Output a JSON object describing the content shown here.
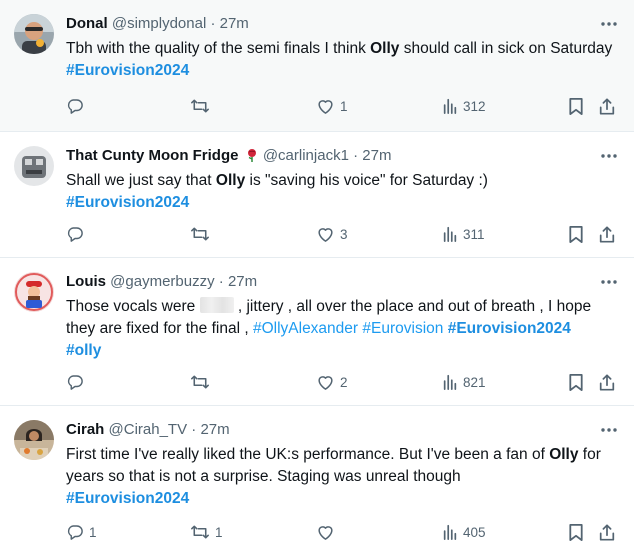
{
  "tweets": [
    {
      "name": "Donal",
      "handle": "@simplydonal",
      "separator": "·",
      "time": "27m",
      "text_parts": [
        "Tbh with the quality of the semi finals I think ",
        "Olly",
        " should call in sick on Saturday ",
        "#Eurovision2024"
      ],
      "replies": "",
      "retweets": "",
      "likes": "1",
      "views": "312"
    },
    {
      "name": "That Cunty Moon Fridge",
      "name_emoji": "rose-icon",
      "handle": "@carlinjack1",
      "separator": "·",
      "time": "27m",
      "text_parts": [
        "Shall we just say that ",
        "Olly",
        " is \"saving his voice\" for Saturday :)",
        "#Eurovision2024"
      ],
      "replies": "",
      "retweets": "",
      "likes": "3",
      "views": "311"
    },
    {
      "name": "Louis",
      "handle": "@gaymerbuzzy",
      "separator": "·",
      "time": "27m",
      "text_parts": [
        "Those vocals were ",
        " , jittery , all over the place and out of breath , I hope they are fixed for the final , ",
        "#OllyAlexander",
        "#Eurovision",
        "#Eurovision2024",
        "#olly"
      ],
      "replies": "",
      "retweets": "",
      "likes": "2",
      "views": "821"
    },
    {
      "name": "Cirah",
      "handle": "@Cirah_TV",
      "separator": "·",
      "time": "27m",
      "text_parts": [
        "First time I've really liked the UK:s performance. But I've been a fan of ",
        "Olly",
        " for years so that is not a surprise. Staging was unreal though",
        "#Eurovision2024"
      ],
      "replies": "1",
      "retweets": "1",
      "likes": "",
      "views": "405"
    }
  ],
  "colors": {
    "link": "#1d9bf0",
    "muted": "#536471",
    "text": "#0f1419",
    "highlight_bg": "#f7f9f9",
    "divider": "#e6ecf0"
  },
  "icons": {
    "reply": "reply-icon",
    "retweet": "retweet-icon",
    "like": "heart-icon",
    "views": "views-chart-icon",
    "bookmark": "bookmark-icon",
    "share": "share-icon",
    "more": "more-dots-icon"
  }
}
